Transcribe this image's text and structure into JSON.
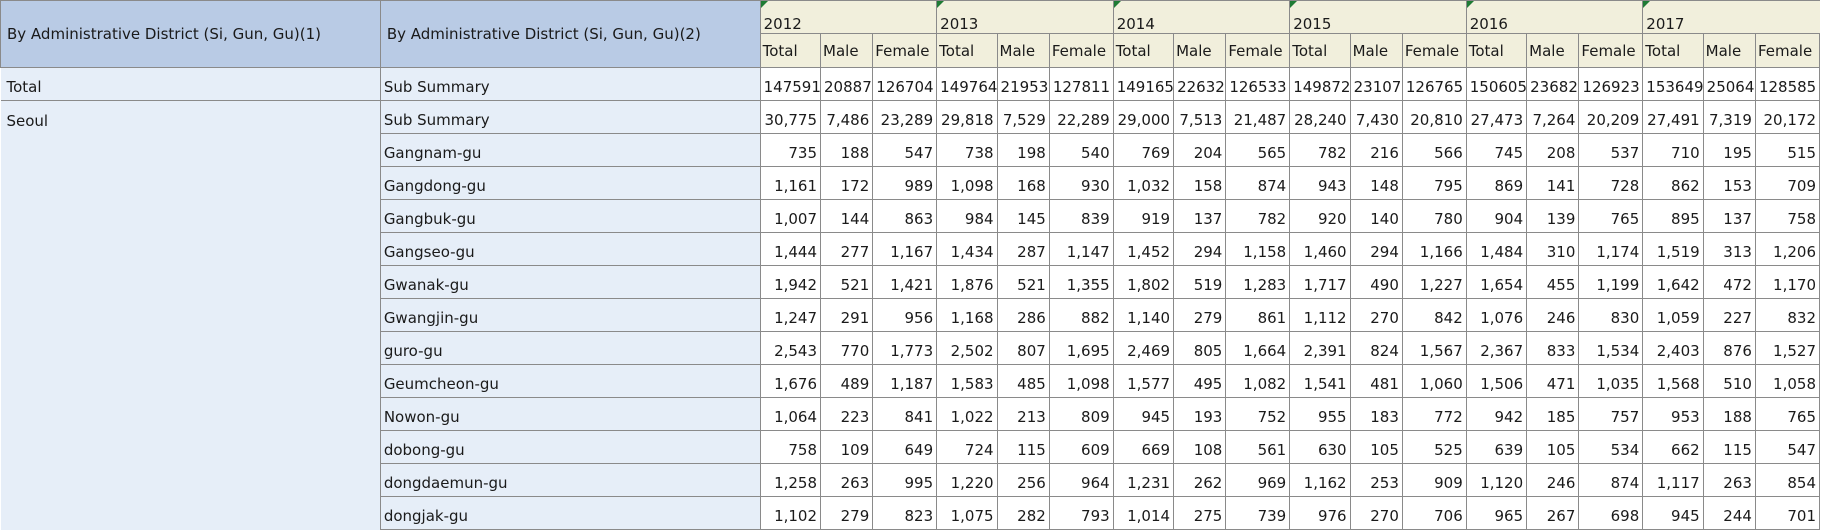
{
  "header": {
    "col_a": "By Administrative District (Si, Gun, Gu)(1)",
    "col_b": "By Administrative District (Si, Gun, Gu)(2)",
    "years": [
      "2012",
      "2013",
      "2014",
      "2015",
      "2016",
      "2017"
    ],
    "sub_total": "Total",
    "sub_male": "Male",
    "sub_female": "Female"
  },
  "rows": [
    {
      "a": "Total",
      "b": "Sub Summary",
      "v": [
        "147591",
        "20887",
        "126704",
        "149764",
        "21953",
        "127811",
        "149165",
        "22632",
        "126533",
        "149872",
        "23107",
        "126765",
        "150605",
        "23682",
        "126923",
        "153649",
        "25064",
        "128585"
      ]
    },
    {
      "a": "Seoul",
      "b": "Sub Summary",
      "v": [
        "30,775",
        "7,486",
        "23,289",
        "29,818",
        "7,529",
        "22,289",
        "29,000",
        "7,513",
        "21,487",
        "28,240",
        "7,430",
        "20,810",
        "27,473",
        "7,264",
        "20,209",
        "27,491",
        "7,319",
        "20,172"
      ]
    },
    {
      "a": "",
      "b": "Gangnam-gu",
      "v": [
        "735",
        "188",
        "547",
        "738",
        "198",
        "540",
        "769",
        "204",
        "565",
        "782",
        "216",
        "566",
        "745",
        "208",
        "537",
        "710",
        "195",
        "515"
      ]
    },
    {
      "a": "",
      "b": "Gangdong-gu",
      "v": [
        "1,161",
        "172",
        "989",
        "1,098",
        "168",
        "930",
        "1,032",
        "158",
        "874",
        "943",
        "148",
        "795",
        "869",
        "141",
        "728",
        "862",
        "153",
        "709"
      ]
    },
    {
      "a": "",
      "b": "Gangbuk-gu",
      "v": [
        "1,007",
        "144",
        "863",
        "984",
        "145",
        "839",
        "919",
        "137",
        "782",
        "920",
        "140",
        "780",
        "904",
        "139",
        "765",
        "895",
        "137",
        "758"
      ]
    },
    {
      "a": "",
      "b": "Gangseo-gu",
      "v": [
        "1,444",
        "277",
        "1,167",
        "1,434",
        "287",
        "1,147",
        "1,452",
        "294",
        "1,158",
        "1,460",
        "294",
        "1,166",
        "1,484",
        "310",
        "1,174",
        "1,519",
        "313",
        "1,206"
      ]
    },
    {
      "a": "",
      "b": "Gwanak-gu",
      "v": [
        "1,942",
        "521",
        "1,421",
        "1,876",
        "521",
        "1,355",
        "1,802",
        "519",
        "1,283",
        "1,717",
        "490",
        "1,227",
        "1,654",
        "455",
        "1,199",
        "1,642",
        "472",
        "1,170"
      ]
    },
    {
      "a": "",
      "b": "Gwangjin-gu",
      "v": [
        "1,247",
        "291",
        "956",
        "1,168",
        "286",
        "882",
        "1,140",
        "279",
        "861",
        "1,112",
        "270",
        "842",
        "1,076",
        "246",
        "830",
        "1,059",
        "227",
        "832"
      ]
    },
    {
      "a": "",
      "b": "guro-gu",
      "v": [
        "2,543",
        "770",
        "1,773",
        "2,502",
        "807",
        "1,695",
        "2,469",
        "805",
        "1,664",
        "2,391",
        "824",
        "1,567",
        "2,367",
        "833",
        "1,534",
        "2,403",
        "876",
        "1,527"
      ]
    },
    {
      "a": "",
      "b": "Geumcheon-gu",
      "v": [
        "1,676",
        "489",
        "1,187",
        "1,583",
        "485",
        "1,098",
        "1,577",
        "495",
        "1,082",
        "1,541",
        "481",
        "1,060",
        "1,506",
        "471",
        "1,035",
        "1,568",
        "510",
        "1,058"
      ]
    },
    {
      "a": "",
      "b": "Nowon-gu",
      "v": [
        "1,064",
        "223",
        "841",
        "1,022",
        "213",
        "809",
        "945",
        "193",
        "752",
        "955",
        "183",
        "772",
        "942",
        "185",
        "757",
        "953",
        "188",
        "765"
      ]
    },
    {
      "a": "",
      "b": "dobong-gu",
      "v": [
        "758",
        "109",
        "649",
        "724",
        "115",
        "609",
        "669",
        "108",
        "561",
        "630",
        "105",
        "525",
        "639",
        "105",
        "534",
        "662",
        "115",
        "547"
      ]
    },
    {
      "a": "",
      "b": "dongdaemun-gu",
      "v": [
        "1,258",
        "263",
        "995",
        "1,220",
        "256",
        "964",
        "1,231",
        "262",
        "969",
        "1,162",
        "253",
        "909",
        "1,120",
        "246",
        "874",
        "1,117",
        "263",
        "854"
      ]
    },
    {
      "a": "",
      "b": "dongjak-gu",
      "v": [
        "1,102",
        "279",
        "823",
        "1,075",
        "282",
        "793",
        "1,014",
        "275",
        "739",
        "976",
        "270",
        "706",
        "965",
        "267",
        "698",
        "945",
        "244",
        "701"
      ]
    }
  ]
}
